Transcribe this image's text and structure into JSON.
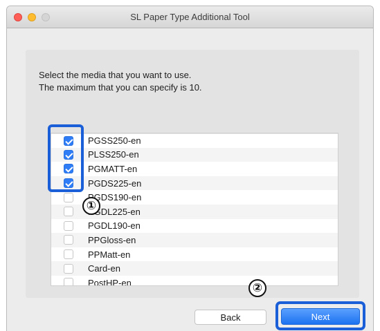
{
  "window": {
    "title": "SL Paper Type Additional Tool"
  },
  "instructions": {
    "line1": "Select the media that you want to use.",
    "line2": "The maximum that you can specify is 10."
  },
  "media_list": [
    {
      "label": "PGSS250-en",
      "checked": true
    },
    {
      "label": "PLSS250-en",
      "checked": true
    },
    {
      "label": "PGMATT-en",
      "checked": true
    },
    {
      "label": "PGDS225-en",
      "checked": true
    },
    {
      "label": "PGDS190-en",
      "checked": false
    },
    {
      "label": "PGDL225-en",
      "checked": false
    },
    {
      "label": "PGDL190-en",
      "checked": false
    },
    {
      "label": "PPGloss-en",
      "checked": false
    },
    {
      "label": "PPMatt-en",
      "checked": false
    },
    {
      "label": "Card-en",
      "checked": false
    },
    {
      "label": "PostHP-en",
      "checked": false
    }
  ],
  "callouts": {
    "one": "①",
    "two": "②"
  },
  "buttons": {
    "back": "Back",
    "next": "Next"
  },
  "colors": {
    "accent": "#1a5fd8",
    "checkbox_checked": "#2f7df6"
  }
}
